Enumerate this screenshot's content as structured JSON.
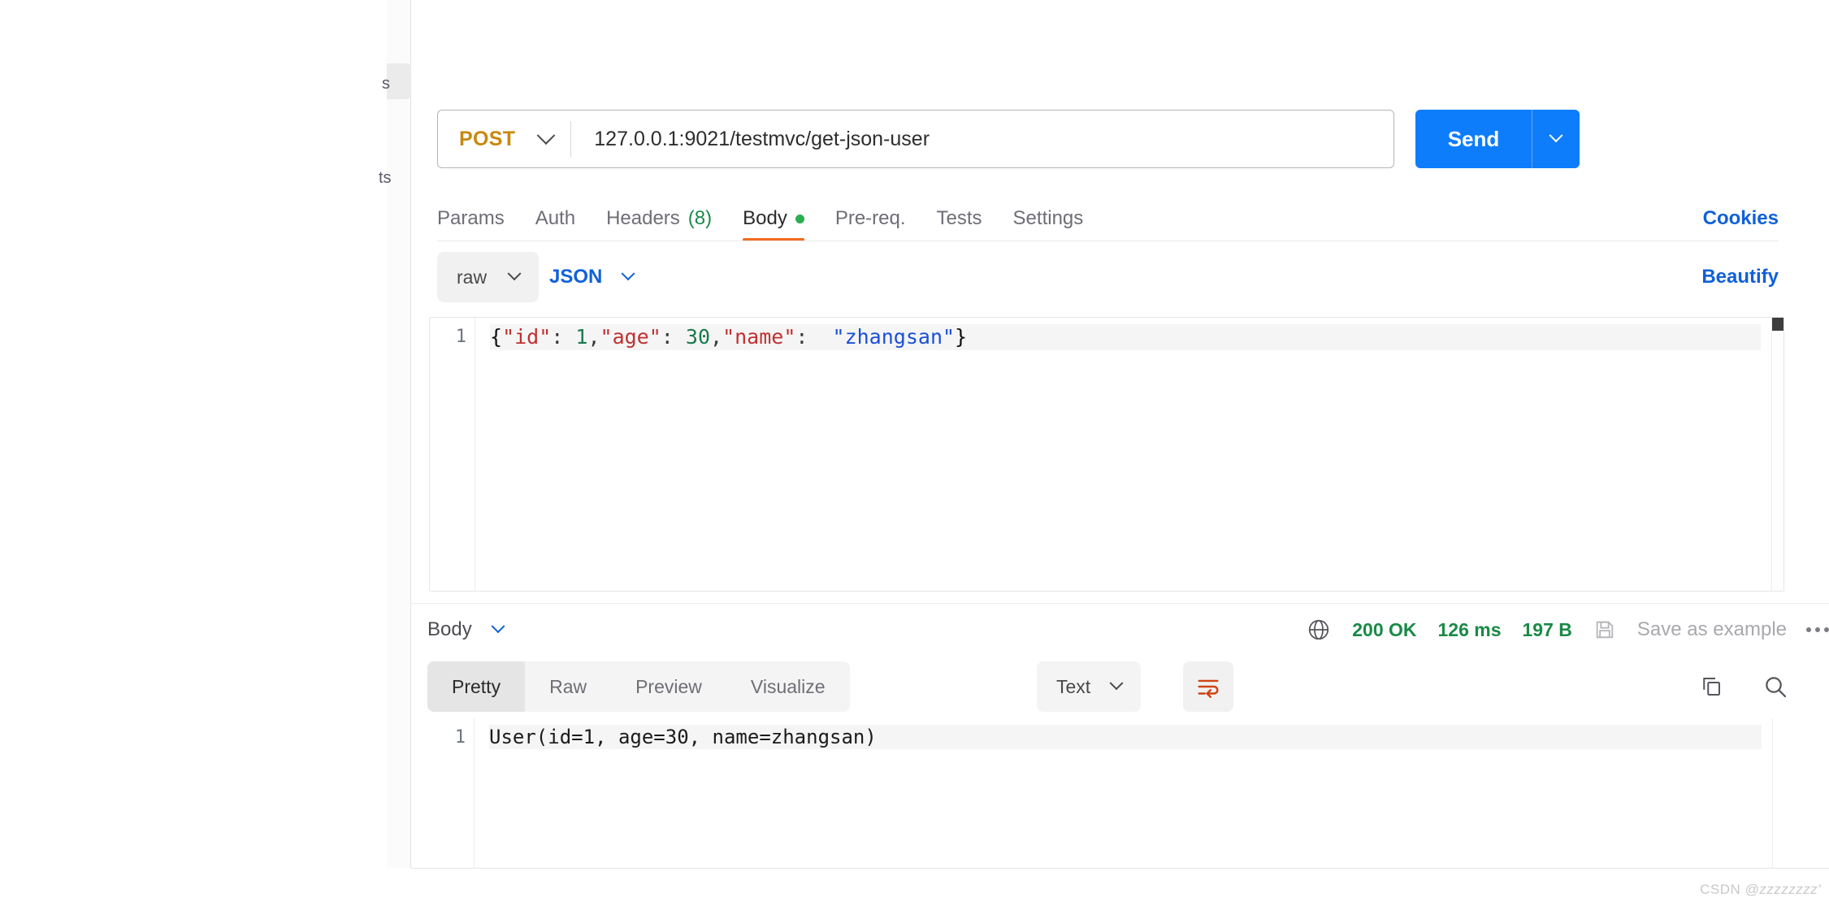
{
  "sidebar": {
    "fragment_top": "s",
    "fragment_bottom": "ts"
  },
  "request": {
    "method": "POST",
    "url": "127.0.0.1:9021/testmvc/get-json-user",
    "send_label": "Send",
    "tabs": [
      {
        "label": "Params",
        "active": false,
        "count": "",
        "dot": false
      },
      {
        "label": "Auth",
        "active": false,
        "count": "",
        "dot": false
      },
      {
        "label": "Headers",
        "active": false,
        "count": "(8)",
        "dot": false
      },
      {
        "label": "Body",
        "active": true,
        "count": "",
        "dot": true
      },
      {
        "label": "Pre-req.",
        "active": false,
        "count": "",
        "dot": false
      },
      {
        "label": "Tests",
        "active": false,
        "count": "",
        "dot": false
      },
      {
        "label": "Settings",
        "active": false,
        "count": "",
        "dot": false
      }
    ],
    "cookies_label": "Cookies",
    "body_mode": "raw",
    "body_format": "JSON",
    "beautify_label": "Beautify",
    "body_line_number": "1",
    "body_tokens": {
      "open_brace": "{",
      "key_id": "\"id\"",
      "colon1": ": ",
      "val_id": "1",
      "comma1": ",",
      "key_age": "\"age\"",
      "colon2": ": ",
      "val_age": "30",
      "comma2": ",",
      "key_name": "\"name\"",
      "colon3": ":  ",
      "val_name": "\"zhangsan\"",
      "close_brace": "}"
    },
    "body_raw": "{\"id\": 1,\"age\": 30,\"name\":  \"zhangsan\"}"
  },
  "response": {
    "section_label": "Body",
    "status_code": "200 OK",
    "time": "126 ms",
    "size": "197 B",
    "save_as_example_label": "Save as example",
    "view_tabs": [
      {
        "label": "Pretty",
        "active": true
      },
      {
        "label": "Raw",
        "active": false
      },
      {
        "label": "Preview",
        "active": false
      },
      {
        "label": "Visualize",
        "active": false
      }
    ],
    "format": "Text",
    "line_number": "1",
    "body_text": "User(id=1, age=30, name=zhangsan)"
  },
  "watermark": {
    "prefix": "CSDN ",
    "handle": "@zzzzzzzz'"
  },
  "colors": {
    "accent_blue": "#0d7dfc",
    "link_blue": "#1061d8",
    "method_orange": "#c9880e",
    "tab_underline": "#f26b21",
    "status_green": "#1a8a46",
    "json_key": "#c03030",
    "json_number": "#1a7a4e",
    "json_string": "#1a4fd6"
  }
}
